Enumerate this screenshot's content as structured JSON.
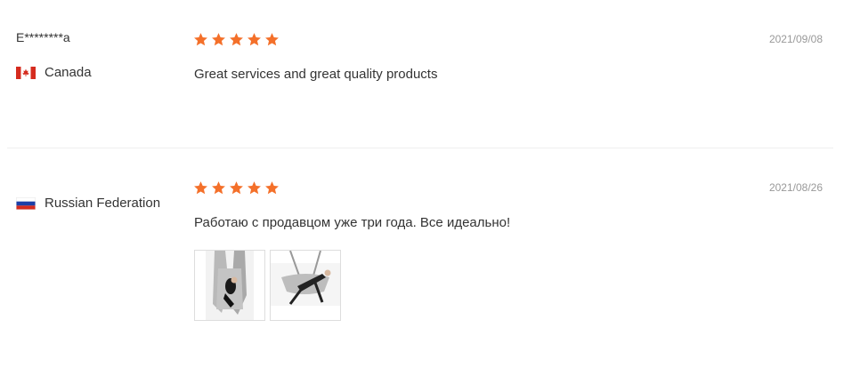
{
  "colors": {
    "star": "#f4702a",
    "date": "#999999",
    "text": "#333333",
    "divider": "#eeeeee"
  },
  "reviews": [
    {
      "user": "E********a",
      "country": "Canada",
      "flag_icon": "canada-flag-icon",
      "rating": 5,
      "date": "2021/09/08",
      "text": "Great services and great quality products",
      "photos": []
    },
    {
      "user": "",
      "country": "Russian Federation",
      "flag_icon": "russia-flag-icon",
      "rating": 5,
      "date": "2021/08/26",
      "text": "Работаю с продавцом уже три года. Все идеально!",
      "photos": [
        "aerial-yoga-hammock-photo",
        "aerial-yoga-pose-photo"
      ]
    }
  ]
}
